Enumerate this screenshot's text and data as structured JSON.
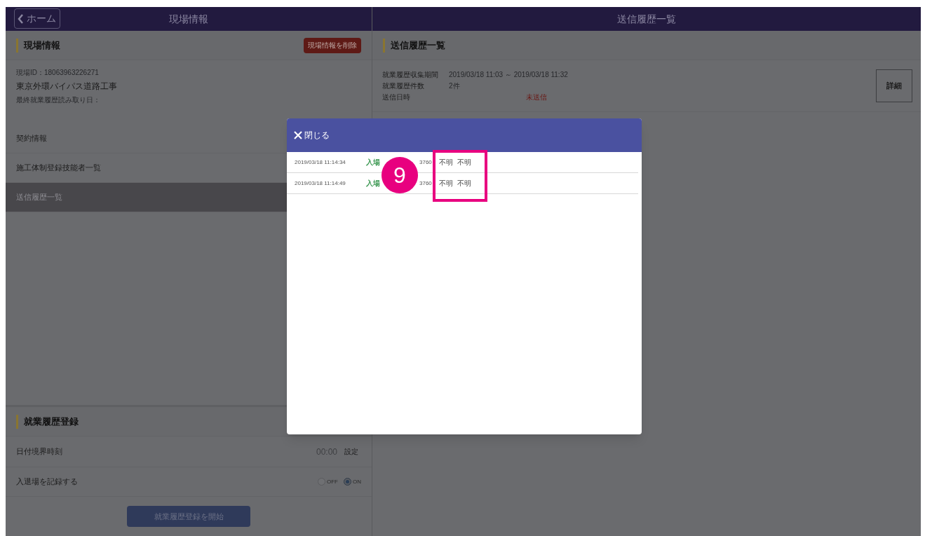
{
  "left_panel": {
    "home_button": "ホーム",
    "title": "現場情報",
    "site_section": {
      "heading": "現場情報",
      "delete_button": "現場情報を削除",
      "site_id": "現場ID：18063963226271",
      "site_name": "東京外環バイパス道路工事",
      "last_read": "最終就業履歴読み取り日："
    },
    "menu": [
      {
        "label": "契約情報",
        "selected": false
      },
      {
        "label": "施工体制登録技能者一覧",
        "selected": false
      },
      {
        "label": "送信履歴一覧",
        "selected": true
      }
    ],
    "registration": {
      "heading": "就業履歴登録",
      "boundary_label": "日付境界時刻",
      "boundary_time": "00:00",
      "set_button": "設定",
      "record_label": "入退場を記録する",
      "options": [
        {
          "label": "OFF",
          "selected": false
        },
        {
          "label": "ON",
          "selected": true
        }
      ],
      "start_button": "就業履歴登録を開始"
    }
  },
  "right_panel": {
    "title": "送信履歴一覧",
    "heading": "送信履歴一覧",
    "fields": [
      {
        "label": "就業履歴収集期間",
        "value": "2019/03/18 11:03 ～ 2019/03/18 11:32",
        "kind": "plain"
      },
      {
        "label": "就業履歴件数",
        "value": "2件",
        "kind": "plain"
      },
      {
        "label": "送信日時",
        "value": "未送信",
        "kind": "alert"
      }
    ],
    "detail_button": "詳細"
  },
  "modal": {
    "close_button": "閉じる",
    "rows": [
      {
        "time": "2019/03/18 11:14:34",
        "type": "入場",
        "number": "3760",
        "column_4": "不明",
        "column_5": "不明"
      },
      {
        "time": "2019/03/18 11:14:49",
        "type": "入場",
        "number": "3760",
        "column_4": "不明",
        "column_5": "不明"
      }
    ]
  },
  "callout": {
    "number": "9"
  }
}
